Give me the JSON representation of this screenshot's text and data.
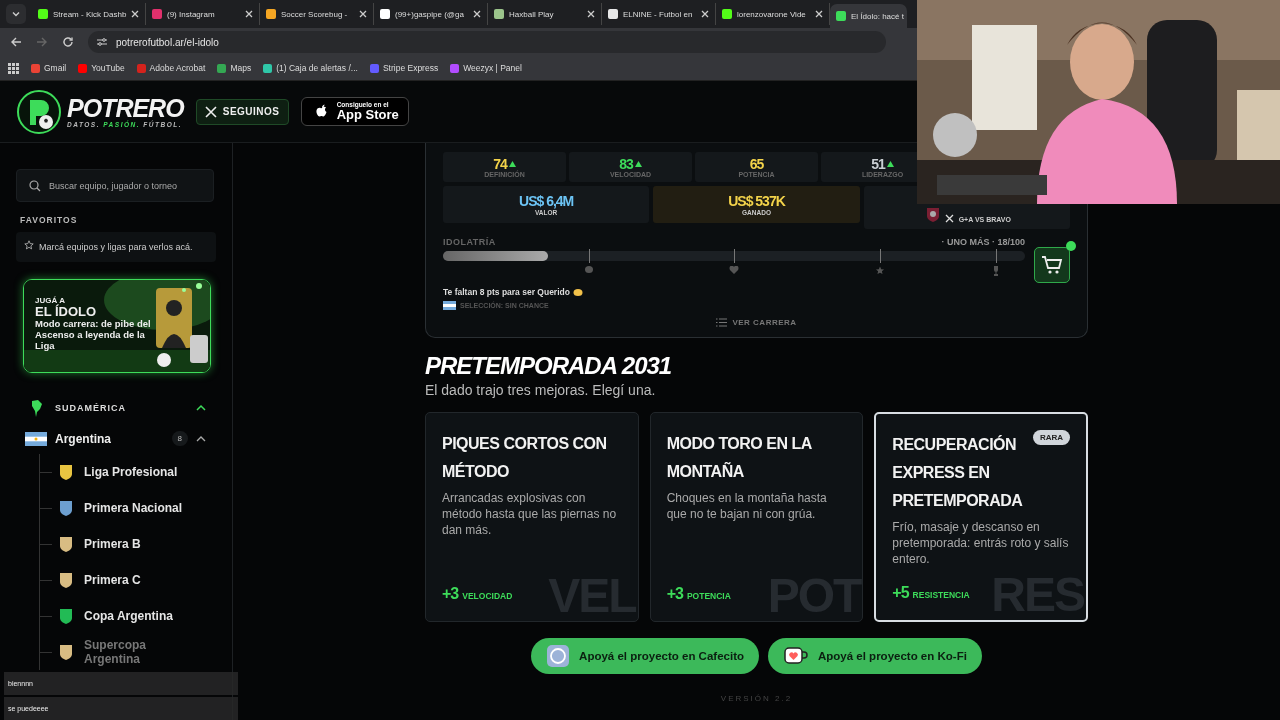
{
  "browser": {
    "tabs": [
      {
        "title": "Stream - Kick Dashb",
        "color": "#53fc18",
        "selected": false
      },
      {
        "title": "(9) Instagram",
        "color": "#e1306c",
        "selected": false
      },
      {
        "title": "Soccer Scorebug - ",
        "color": "#f5a623",
        "selected": false
      },
      {
        "title": "(99+)gaspipe (@ga",
        "color": "#ffffff",
        "selected": false
      },
      {
        "title": "Haxball Play",
        "color": "#9bc48b",
        "selected": false
      },
      {
        "title": "ELNINE - Futbol en",
        "color": "#e8e8e8",
        "selected": false
      },
      {
        "title": "lorenzovarone Vide",
        "color": "#53fc18",
        "selected": false
      },
      {
        "title": "El Ídolo: hacé t",
        "color": "#3ddc5a",
        "selected": true
      }
    ],
    "url": "potrerofutbol.ar/el-idolo",
    "bookmarks": [
      {
        "label": "Gmail",
        "color": "#ea4335"
      },
      {
        "label": "YouTube",
        "color": "#ff0000"
      },
      {
        "label": "Adobe Acrobat",
        "color": "#d4231d"
      },
      {
        "label": "Maps",
        "color": "#34a853"
      },
      {
        "label": "(1) Caja de alertas /...",
        "color": "#2fc7a8"
      },
      {
        "label": "Stripe Express",
        "color": "#635bff"
      },
      {
        "label": "Weezyx | Panel",
        "color": "#b24cff"
      }
    ]
  },
  "header": {
    "brand": "POTRERO",
    "tagline": [
      "DATOS.",
      "PASIÓN.",
      "FÚTBOL."
    ],
    "follow_button": "SEGUINOS",
    "store_small": "Consiguelo en el",
    "store_big": "App Store"
  },
  "sidebar": {
    "search": {
      "placeholder": "Buscar equipo, jugador o torneo"
    },
    "favorites_title": "FAVORITOS",
    "favorites_hint": "Marcá equipos y ligas para verlos acá.",
    "promo": {
      "kicker": "JUGÁ A",
      "title": "EL ÍDOLO",
      "text": "Modo carrera: de pibe del Ascenso a leyenda de la Liga"
    },
    "region": {
      "label": "SUDAMÉRICA",
      "expanded": true,
      "countries": [
        {
          "name": "Argentina",
          "count": "8",
          "expanded": true,
          "children": [
            {
              "name": "Liga Profesional"
            },
            {
              "name": "Primera Nacional"
            },
            {
              "name": "Primera B"
            },
            {
              "name": "Primera C"
            },
            {
              "name": "Copa Argentina"
            },
            {
              "name": "Supercopa Argentina"
            }
          ]
        }
      ]
    }
  },
  "chat": [
    {
      "message": "biennnn"
    },
    {
      "message": "se puedeeee"
    }
  ],
  "career": {
    "stats": [
      {
        "value": "74",
        "label": "DEFINICIÓN",
        "color": "#f3d34a",
        "up": true
      },
      {
        "value": "83",
        "label": "VELOCIDAD",
        "color": "#3ddc5a",
        "up": true
      },
      {
        "value": "65",
        "label": "POTENCIA",
        "color": "#f3d34a",
        "up": false
      },
      {
        "value": "51",
        "label": "LIDERAZGO",
        "color": "#c9ced3",
        "up": true
      }
    ],
    "money": [
      {
        "value": "US$ 6,4M",
        "label": "VALOR",
        "color": "#6cc4f5",
        "highlight": false
      },
      {
        "value": "US$ 537K",
        "label": "GANADO",
        "color": "#f3d34a",
        "highlight": true
      }
    ],
    "rival": "G+A VS BRAVO",
    "idolatry": {
      "label": "IDOLATRÍA",
      "status": "· UNO MÁS · 18/100",
      "level": 0.18
    },
    "cart_notification": true,
    "hint": "Te faltan 8 pts para ser Querido",
    "selection": "SELECCIÓN: SIN CHANCE",
    "link": "VER CARRERA"
  },
  "preseason": {
    "title": "PRETEMPORADA 2031",
    "subtitle": "El dado trajo tres mejoras. Elegí una.",
    "options": [
      {
        "title": "PIQUES CORTOS CON MÉTODO",
        "text": "Arrancadas explosivas con método hasta que las piernas no dan más.",
        "bonus": "+3",
        "stat": "VELOCIDAD",
        "watermark": "VEL",
        "selected": false
      },
      {
        "title": "MODO TORO EN LA MONTAÑA",
        "text": "Choques en la montaña hasta que no te bajan ni con grúa.",
        "bonus": "+3",
        "stat": "POTENCIA",
        "watermark": "POT",
        "selected": false
      },
      {
        "title": "RECUPERACIÓN EXPRESS EN PRETEMPORADA",
        "text": "Frío, masaje y descanso en pretemporada: entrás roto y salís entero.",
        "bonus": "+5",
        "stat": "RESISTENCIA",
        "watermark": "RES",
        "badge": "RARA",
        "selected": true
      }
    ]
  },
  "support": [
    {
      "kind": "cafecito",
      "label": "Apoyá el proyecto en Cafecito"
    },
    {
      "kind": "kofi",
      "label": "Apoyá el proyecto en Ko-Fi"
    }
  ],
  "version": "VERSIÓN 2.2"
}
